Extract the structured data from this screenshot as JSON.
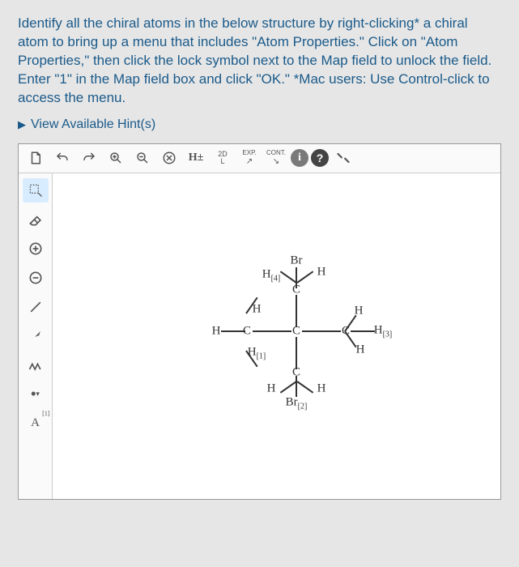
{
  "instructions": "Identify all the chiral atoms in the below structure by right-clicking* a chiral atom to bring up a menu that includes \"Atom Properties.\" Click on \"Atom Properties,\" then click the lock symbol next to the Map field to unlock the field. Enter \"1\" in the Map field box and click \"OK.\"   *Mac users: Use Control-click to access the menu.",
  "hints_label": "View Available Hint(s)",
  "toolbar": {
    "new": "new-file-icon",
    "undo": "undo-icon",
    "redo": "redo-icon",
    "zoom_in": "zoom-in-icon",
    "zoom_out": "zoom-out-icon",
    "delete": "delete-icon",
    "hydrogens": "H±",
    "twod": "2D",
    "twod_sub": "L",
    "exp": "EXP.",
    "cont": "CONT.",
    "info": "i",
    "help": "?",
    "fullscreen": "fullscreen-icon"
  },
  "side": {
    "selection": "selection-icon",
    "eraser": "eraser-icon",
    "plus": "plus-icon",
    "minus": "minus-icon",
    "single_bond": "single-bond-icon",
    "wedge": "wedge-icon",
    "chain": "chain-icon",
    "charge": "charge-icon",
    "map": "A",
    "map_sup": "[1]"
  },
  "molecule": {
    "atoms": {
      "Br_top": "Br",
      "H4": "H",
      "H4_sub": "[4]",
      "H_top_right": "H",
      "C_top": "C",
      "H_left_up": "H",
      "H_left": "H",
      "C_left": "C",
      "C_mid": "C",
      "C_right": "C",
      "H_right_up": "H",
      "H3": "H",
      "H3_sub": "[3]",
      "H1": "H",
      "H1_sub": "[1]",
      "H_right_low": "H",
      "C_bot": "C",
      "H_bot_left": "H",
      "H_bot_right": "H",
      "Br_bot": "Br",
      "Br_bot_sub": "[2]"
    }
  },
  "chart_data": {
    "type": "table",
    "title": "Molecular structure for chiral atom identification",
    "atoms": [
      {
        "id": "C1",
        "element": "C",
        "bonds_to": [
          "H",
          "H",
          "H[1]",
          "C2"
        ],
        "note": "left carbon"
      },
      {
        "id": "C2",
        "element": "C",
        "bonds_to": [
          "C1",
          "C3",
          "C_top",
          "C_bot"
        ],
        "note": "center carbon"
      },
      {
        "id": "C3",
        "element": "C",
        "bonds_to": [
          "H",
          "H",
          "H[3]",
          "C2"
        ],
        "note": "right carbon"
      },
      {
        "id": "C_top",
        "element": "C",
        "bonds_to": [
          "Br",
          "H[4]",
          "H",
          "C2"
        ],
        "note": "top carbon"
      },
      {
        "id": "C_bot",
        "element": "C",
        "bonds_to": [
          "H",
          "H",
          "Br[2]",
          "C2"
        ],
        "note": "bottom carbon"
      }
    ],
    "substituent_labels": [
      "H[1]",
      "Br[2]",
      "H[3]",
      "H[4]"
    ]
  }
}
